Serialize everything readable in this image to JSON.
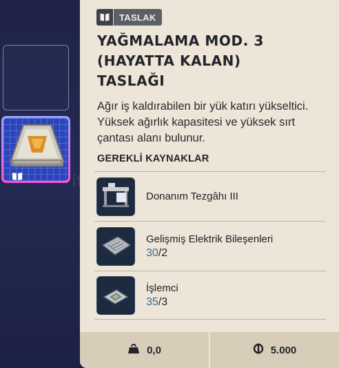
{
  "inventory": {
    "selected_item": "loot-module-blueprint",
    "selected_item_badge_icon": "book-icon"
  },
  "panel": {
    "category_icon": "book-icon",
    "category_label": "TASLAK",
    "title": "YAĞMALAMA MOD. 3\n(HAYATTA KALAN)\nTASLAĞI",
    "description": "Ağır iş kaldırabilen bir yük katırı yükseltici. Yüksek ağırlık kapasitesi ve yüksek sırt çantası alanı bulunur.",
    "requirements_heading": "GEREKLİ KAYNAKLAR",
    "requirements": [
      {
        "name": "Donanım Tezgâhı III",
        "have": "",
        "need": "",
        "icon": "workbench-icon"
      },
      {
        "name": "Gelişmiş Elektrik Bileşenleri",
        "have": "30",
        "need": "/2",
        "icon": "electrical-components-icon"
      },
      {
        "name": "İşlemci",
        "have": "35",
        "need": "/3",
        "icon": "processor-icon"
      }
    ]
  },
  "footer": {
    "weight_icon": "weight-icon",
    "weight_value": "0,0",
    "price_icon": "currency-icon",
    "price_value": "5.000"
  },
  "colors": {
    "background": "#1f2347",
    "panel": "#ece5d8",
    "footer": "#d8cdb8",
    "have_count": "#3a6f86",
    "selected_border": "#c07cff"
  },
  "watermark": "itemsatış"
}
